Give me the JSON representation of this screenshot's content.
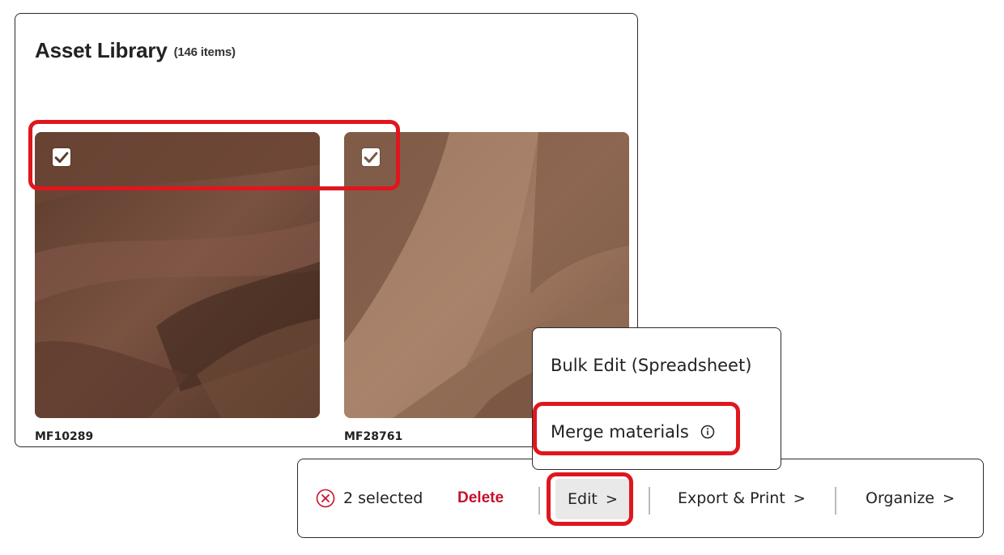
{
  "library": {
    "title": "Asset Library",
    "count": "(146 items)"
  },
  "assets": [
    {
      "id": "MF10289",
      "selected": true,
      "color": "#6e4a38"
    },
    {
      "id": "MF28761",
      "selected": true,
      "color": "#8f6a54"
    }
  ],
  "dropdown": {
    "items": [
      {
        "label": "Bulk Edit (Spreadsheet)"
      },
      {
        "label": "Merge materials",
        "icon": "info-icon"
      }
    ]
  },
  "action_bar": {
    "selected_text": "2 selected",
    "delete_label": "Delete",
    "edit_label": "Edit",
    "export_label": "Export & Print",
    "organize_label": "Organize",
    "chevron": ">"
  },
  "colors": {
    "highlight": "#e0161e",
    "delete": "#c8102e",
    "edit_bg": "#e9e9e9"
  }
}
